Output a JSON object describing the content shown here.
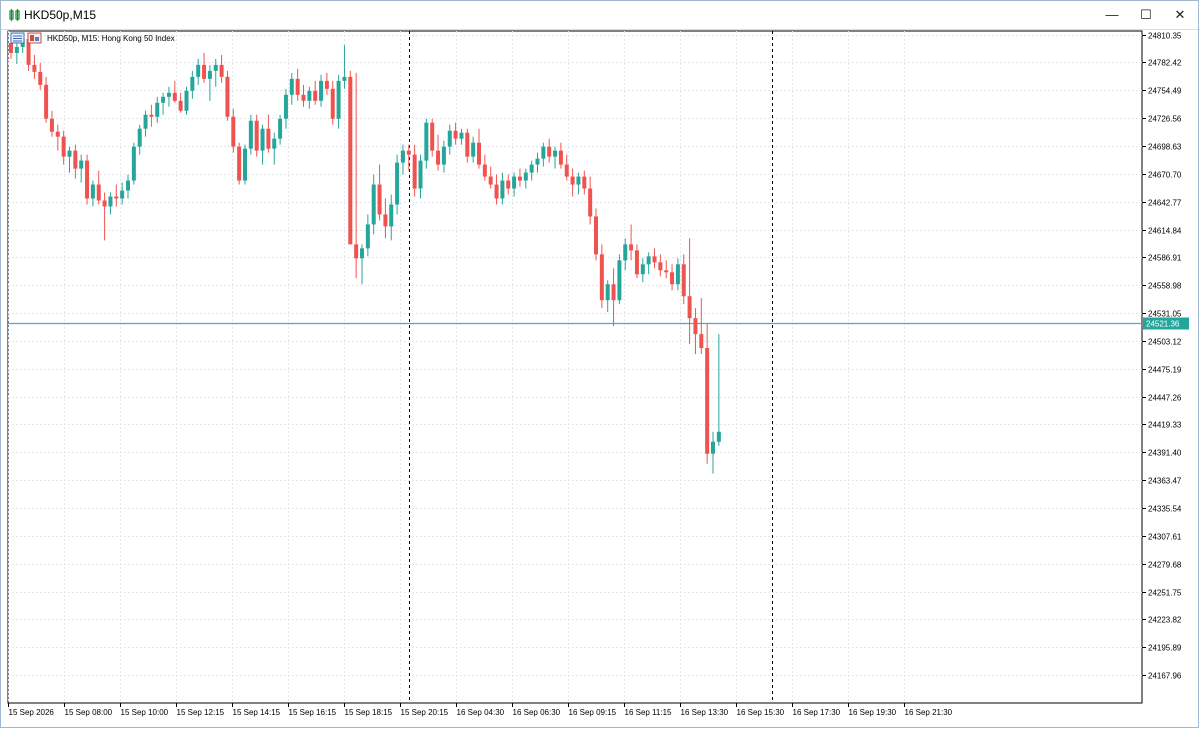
{
  "window": {
    "title": "HKD50p,M15",
    "minimize_glyph": "—",
    "maximize_glyph": "☐",
    "close_glyph": "✕"
  },
  "chart_header": {
    "label": "HKD50p, M15:  Hong Kong 50 Index"
  },
  "colors": {
    "up": "#26a69a",
    "down": "#ef5350",
    "grid": "#e3e6ea",
    "bid_line": "#5aa2c8",
    "price_tag_bg": "#26a69a",
    "axis": "#000000"
  },
  "icons": [
    "app-icon",
    "trade-panel-icon",
    "depth-of-market-icon"
  ],
  "chart_data": {
    "type": "candlestick",
    "symbol": "HKD50p",
    "timeframe": "M15",
    "description": "Hong Kong 50 Index",
    "y_ticks": [
      24810.35,
      24782.42,
      24754.49,
      24726.56,
      24698.63,
      24670.7,
      24642.77,
      24614.84,
      24586.91,
      24558.98,
      24531.05,
      24503.12,
      24475.19,
      24447.26,
      24419.33,
      24391.4,
      24363.47,
      24335.54,
      24307.61,
      24279.68,
      24251.75,
      24223.82,
      24195.89,
      24167.96
    ],
    "ylim": [
      24140.0,
      24814.0
    ],
    "x_tick_labels": [
      "15 Sep 2026",
      "15 Sep 08:00",
      "15 Sep 10:00",
      "15 Sep 12:15",
      "15 Sep 14:15",
      "15 Sep 16:15",
      "15 Sep 18:15",
      "15 Sep 20:15",
      "16 Sep 04:30",
      "16 Sep 06:30",
      "16 Sep 09:15",
      "16 Sep 11:15",
      "16 Sep 13:30",
      "16 Sep 15:30",
      "16 Sep 17:30",
      "16 Sep 19:30",
      "16 Sep 21:30"
    ],
    "session_separator_indices": [
      68,
      130
    ],
    "current_price": 24521.36,
    "current_price_label": "24521.36",
    "grid": true,
    "candles": [
      [
        24802,
        24812,
        24786,
        24792
      ],
      [
        24792,
        24806,
        24781,
        24798
      ],
      [
        24798,
        24810,
        24792,
        24806
      ],
      [
        24806,
        24812,
        24774,
        24780
      ],
      [
        24780,
        24790,
        24766,
        24773
      ],
      [
        24773,
        24782,
        24755,
        24760
      ],
      [
        24760,
        24768,
        24722,
        24726
      ],
      [
        24726,
        24734,
        24708,
        24713
      ],
      [
        24713,
        24720,
        24694,
        24708
      ],
      [
        24708,
        24714,
        24680,
        24688
      ],
      [
        24688,
        24698,
        24672,
        24694
      ],
      [
        24694,
        24700,
        24666,
        24676
      ],
      [
        24676,
        24690,
        24662,
        24684
      ],
      [
        24684,
        24690,
        24640,
        24646
      ],
      [
        24646,
        24664,
        24638,
        24660
      ],
      [
        24660,
        24674,
        24640,
        24644
      ],
      [
        24644,
        24652,
        24604,
        24638
      ],
      [
        24638,
        24652,
        24630,
        24648
      ],
      [
        24648,
        24660,
        24638,
        24646
      ],
      [
        24646,
        24662,
        24640,
        24654
      ],
      [
        24654,
        24670,
        24646,
        24664
      ],
      [
        24664,
        24702,
        24660,
        24698
      ],
      [
        24698,
        24720,
        24690,
        24716
      ],
      [
        24716,
        24734,
        24708,
        24730
      ],
      [
        24730,
        24740,
        24718,
        24728
      ],
      [
        24728,
        24748,
        24722,
        24742
      ],
      [
        24742,
        24752,
        24730,
        24748
      ],
      [
        24748,
        24758,
        24738,
        24752
      ],
      [
        24752,
        24764,
        24742,
        24744
      ],
      [
        24744,
        24752,
        24732,
        24734
      ],
      [
        24734,
        24758,
        24730,
        24754
      ],
      [
        24754,
        24774,
        24746,
        24768
      ],
      [
        24768,
        24786,
        24760,
        24780
      ],
      [
        24780,
        24792,
        24762,
        24766
      ],
      [
        24766,
        24780,
        24744,
        24774
      ],
      [
        24774,
        24786,
        24758,
        24780
      ],
      [
        24780,
        24790,
        24762,
        24768
      ],
      [
        24768,
        24774,
        24724,
        24728
      ],
      [
        24728,
        24736,
        24692,
        24698
      ],
      [
        24698,
        24702,
        24660,
        24664
      ],
      [
        24664,
        24700,
        24660,
        24696
      ],
      [
        24696,
        24730,
        24690,
        24724
      ],
      [
        24724,
        24730,
        24688,
        24694
      ],
      [
        24694,
        24720,
        24680,
        24716
      ],
      [
        24716,
        24730,
        24692,
        24696
      ],
      [
        24696,
        24712,
        24680,
        24706
      ],
      [
        24706,
        24730,
        24700,
        24726
      ],
      [
        24726,
        24756,
        24716,
        24750
      ],
      [
        24750,
        24772,
        24740,
        24766
      ],
      [
        24766,
        24776,
        24744,
        24750
      ],
      [
        24750,
        24760,
        24738,
        24744
      ],
      [
        24744,
        24758,
        24736,
        24754
      ],
      [
        24754,
        24764,
        24740,
        24744
      ],
      [
        24744,
        24770,
        24738,
        24764
      ],
      [
        24764,
        24772,
        24750,
        24756
      ],
      [
        24756,
        24764,
        24720,
        24726
      ],
      [
        24726,
        24770,
        24716,
        24764
      ],
      [
        24764,
        24800,
        24756,
        24768
      ],
      [
        24768,
        24774,
        24672,
        24600
      ],
      [
        24600,
        24772,
        24566,
        24586
      ],
      [
        24586,
        24600,
        24560,
        24596
      ],
      [
        24596,
        24630,
        24588,
        24620
      ],
      [
        24620,
        24670,
        24610,
        24660
      ],
      [
        24660,
        24680,
        24624,
        24630
      ],
      [
        24630,
        24646,
        24606,
        24618
      ],
      [
        24618,
        24650,
        24604,
        24640
      ],
      [
        24640,
        24690,
        24630,
        24682
      ],
      [
        24682,
        24700,
        24670,
        24694
      ],
      [
        24694,
        24700,
        24674,
        24690
      ],
      [
        24690,
        24700,
        24648,
        24656
      ],
      [
        24656,
        24690,
        24646,
        24684
      ],
      [
        24684,
        24726,
        24676,
        24722
      ],
      [
        24722,
        24726,
        24688,
        24694
      ],
      [
        24694,
        24710,
        24674,
        24680
      ],
      [
        24680,
        24704,
        24672,
        24698
      ],
      [
        24698,
        24720,
        24690,
        24714
      ],
      [
        24714,
        24722,
        24700,
        24706
      ],
      [
        24706,
        24716,
        24700,
        24712
      ],
      [
        24712,
        24716,
        24682,
        24688
      ],
      [
        24688,
        24708,
        24682,
        24702
      ],
      [
        24702,
        24716,
        24676,
        24680
      ],
      [
        24680,
        24690,
        24664,
        24668
      ],
      [
        24668,
        24678,
        24656,
        24660
      ],
      [
        24660,
        24670,
        24640,
        24646
      ],
      [
        24646,
        24672,
        24640,
        24664
      ],
      [
        24664,
        24670,
        24650,
        24656
      ],
      [
        24656,
        24672,
        24648,
        24668
      ],
      [
        24668,
        24676,
        24658,
        24664
      ],
      [
        24664,
        24676,
        24656,
        24672
      ],
      [
        24672,
        24684,
        24664,
        24680
      ],
      [
        24680,
        24692,
        24672,
        24686
      ],
      [
        24686,
        24702,
        24678,
        24698
      ],
      [
        24698,
        24706,
        24682,
        24688
      ],
      [
        24688,
        24698,
        24676,
        24694
      ],
      [
        24694,
        24702,
        24676,
        24680
      ],
      [
        24680,
        24690,
        24664,
        24668
      ],
      [
        24668,
        24676,
        24648,
        24660
      ],
      [
        24660,
        24672,
        24650,
        24668
      ],
      [
        24668,
        24674,
        24650,
        24656
      ],
      [
        24656,
        24668,
        24620,
        24628
      ],
      [
        24628,
        24636,
        24584,
        24590
      ],
      [
        24590,
        24600,
        24536,
        24544
      ],
      [
        24544,
        24564,
        24532,
        24560
      ],
      [
        24560,
        24576,
        24518,
        24544
      ],
      [
        24544,
        24590,
        24540,
        24584
      ],
      [
        24584,
        24606,
        24574,
        24600
      ],
      [
        24600,
        24620,
        24584,
        24594
      ],
      [
        24594,
        24600,
        24566,
        24570
      ],
      [
        24570,
        24586,
        24562,
        24580
      ],
      [
        24580,
        24592,
        24570,
        24588
      ],
      [
        24588,
        24596,
        24576,
        24582
      ],
      [
        24582,
        24590,
        24568,
        24574
      ],
      [
        24574,
        24584,
        24566,
        24572
      ],
      [
        24572,
        24580,
        24554,
        24560
      ],
      [
        24560,
        24586,
        24554,
        24580
      ],
      [
        24580,
        24590,
        24540,
        24548
      ],
      [
        24548,
        24606,
        24500,
        24526
      ],
      [
        24526,
        24536,
        24490,
        24510
      ],
      [
        24510,
        24546,
        24490,
        24496
      ],
      [
        24496,
        24520,
        24380,
        24390
      ],
      [
        24390,
        24412,
        24370,
        24402
      ],
      [
        24402,
        24510,
        24398,
        24412
      ]
    ]
  }
}
